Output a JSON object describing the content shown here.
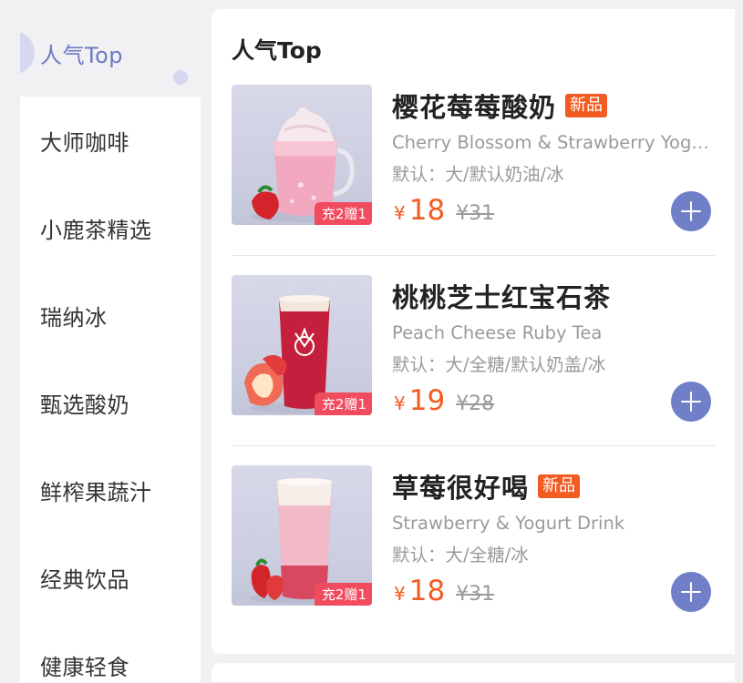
{
  "sidebar": {
    "categories": [
      {
        "label": "人气Top",
        "active": true
      },
      {
        "label": "大师咖啡"
      },
      {
        "label": "小鹿茶精选"
      },
      {
        "label": "瑞纳冰"
      },
      {
        "label": "甄选酸奶"
      },
      {
        "label": "鲜榨果蔬汁"
      },
      {
        "label": "经典饮品"
      },
      {
        "label": "健康轻食"
      }
    ]
  },
  "main": {
    "section_title": "人气Top",
    "products": [
      {
        "name": "樱花莓莓酸奶",
        "badge": "新品",
        "english_name": "Cherry Blossom & Strawberry Yogurt",
        "options": "默认：大/默认奶油/冰",
        "currency": "¥",
        "price": "18",
        "original_price": "¥31",
        "promo_tag": "充2赠1",
        "image_icon": "pink-yogurt-drink-icon"
      },
      {
        "name": "桃桃芝士红宝石茶",
        "badge": "",
        "english_name": "Peach Cheese Ruby Tea",
        "options": "默认：大/全糖/默认奶盖/冰",
        "currency": "¥",
        "price": "19",
        "original_price": "¥28",
        "promo_tag": "充2赠1",
        "image_icon": "red-tea-cup-icon"
      },
      {
        "name": "草莓很好喝",
        "badge": "新品",
        "english_name": "Strawberry & Yogurt Drink",
        "options": "默认：大/全糖/冰",
        "currency": "¥",
        "price": "18",
        "original_price": "¥31",
        "promo_tag": "充2赠1",
        "image_icon": "strawberry-yogurt-cup-icon"
      }
    ]
  },
  "colors": {
    "accent": "#6e79c4",
    "add_button": "#7080c8",
    "price": "#f25b21",
    "promo": "#f14b5e",
    "background": "#f1f1f4"
  }
}
